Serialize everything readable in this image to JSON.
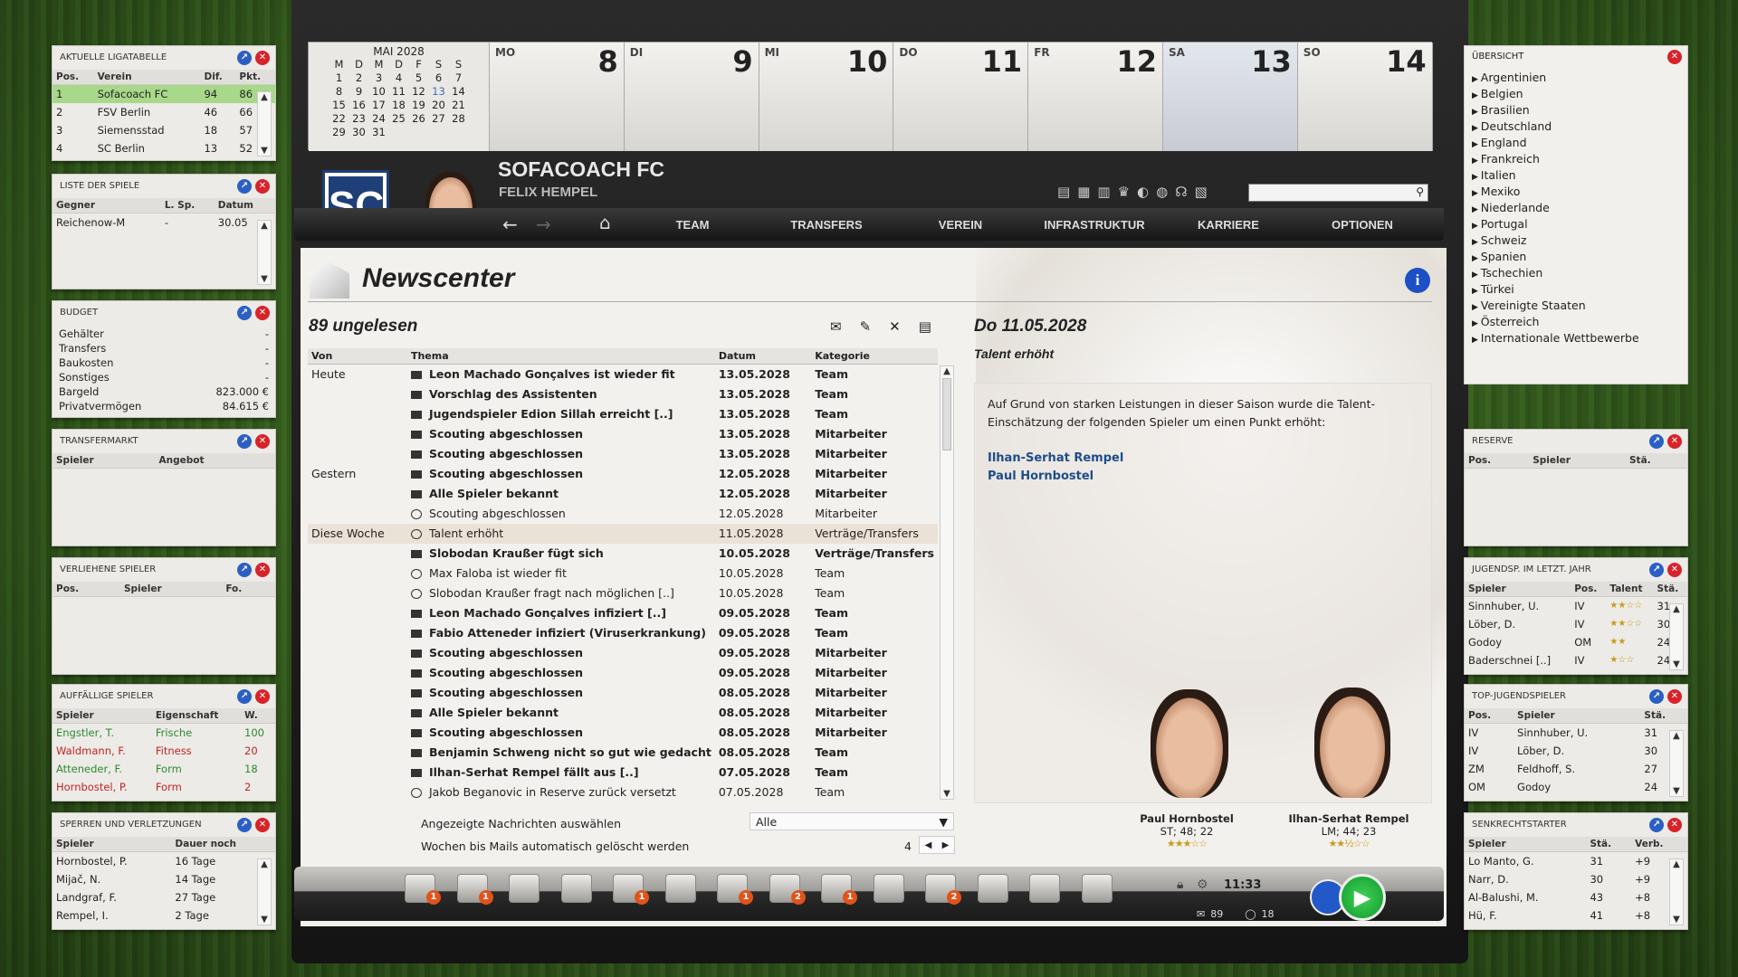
{
  "calendar": {
    "month": "MAI 2028",
    "weekdays": [
      "M",
      "D",
      "M",
      "D",
      "F",
      "S",
      "S"
    ],
    "rows": [
      [
        "1",
        "2",
        "3",
        "4",
        "5",
        "6",
        "7"
      ],
      [
        "8",
        "9",
        "10",
        "11",
        "12",
        "13",
        "14"
      ],
      [
        "15",
        "16",
        "17",
        "18",
        "19",
        "20",
        "21"
      ],
      [
        "22",
        "23",
        "24",
        "25",
        "26",
        "27",
        "28"
      ],
      [
        "29",
        "30",
        "31",
        "",
        "",
        "",
        ""
      ]
    ],
    "days": [
      {
        "label": "MO",
        "num": "8"
      },
      {
        "label": "DI",
        "num": "9"
      },
      {
        "label": "MI",
        "num": "10"
      },
      {
        "label": "DO",
        "num": "11"
      },
      {
        "label": "FR",
        "num": "12"
      },
      {
        "label": "SA",
        "num": "13"
      },
      {
        "label": "SO",
        "num": "14"
      }
    ]
  },
  "club": {
    "name": "SOFACOACH FC",
    "manager": "FELIX HEMPEL",
    "logo": "SC"
  },
  "nav": [
    "TEAM",
    "TRANSFERS",
    "VEREIN",
    "INFRASTRUKTUR",
    "KARRIERE",
    "OPTIONEN"
  ],
  "news": {
    "title": "Newscenter",
    "unread": "89 ungelesen",
    "headers": {
      "von": "Von",
      "thema": "Thema",
      "datum": "Datum",
      "kategorie": "Kategorie"
    },
    "rows": [
      {
        "von": "Heute",
        "thema": "Leon Machado Gonçalves ist wieder fit",
        "datum": "13.05.2028",
        "kat": "Team",
        "bold": true,
        "icon": "mail"
      },
      {
        "von": "",
        "thema": "Vorschlag des Assistenten",
        "datum": "13.05.2028",
        "kat": "Team",
        "bold": true,
        "icon": "mail"
      },
      {
        "von": "",
        "thema": "Jugendspieler Edion Sillah erreicht [..]",
        "datum": "13.05.2028",
        "kat": "Team",
        "bold": true,
        "icon": "mail"
      },
      {
        "von": "",
        "thema": "Scouting abgeschlossen",
        "datum": "13.05.2028",
        "kat": "Mitarbeiter",
        "bold": true,
        "icon": "mail"
      },
      {
        "von": "",
        "thema": "Scouting abgeschlossen",
        "datum": "13.05.2028",
        "kat": "Mitarbeiter",
        "bold": true,
        "icon": "mail"
      },
      {
        "von": "Gestern",
        "thema": "Scouting abgeschlossen",
        "datum": "12.05.2028",
        "kat": "Mitarbeiter",
        "bold": true,
        "icon": "mail"
      },
      {
        "von": "",
        "thema": "Alle Spieler bekannt",
        "datum": "12.05.2028",
        "kat": "Mitarbeiter",
        "bold": true,
        "icon": "mail"
      },
      {
        "von": "",
        "thema": "Scouting abgeschlossen",
        "datum": "12.05.2028",
        "kat": "Mitarbeiter",
        "bold": false,
        "icon": "bubble"
      },
      {
        "von": "Diese Woche",
        "thema": "Talent erhöht",
        "datum": "11.05.2028",
        "kat": "Verträge/Transfers",
        "bold": false,
        "icon": "bubble",
        "hl": true
      },
      {
        "von": "",
        "thema": "Slobodan Kraußer fügt sich",
        "datum": "10.05.2028",
        "kat": "Verträge/Transfers",
        "bold": true,
        "icon": "mail"
      },
      {
        "von": "",
        "thema": "Max Faloba ist wieder fit",
        "datum": "10.05.2028",
        "kat": "Team",
        "bold": false,
        "icon": "bubble"
      },
      {
        "von": "",
        "thema": "Slobodan Kraußer fragt nach möglichen [..]",
        "datum": "10.05.2028",
        "kat": "Team",
        "bold": false,
        "icon": "bubble"
      },
      {
        "von": "",
        "thema": "Leon Machado Gonçalves infiziert [..]",
        "datum": "09.05.2028",
        "kat": "Team",
        "bold": true,
        "icon": "mail"
      },
      {
        "von": "",
        "thema": "Fabio Atteneder infiziert (Viruserkrankung)",
        "datum": "09.05.2028",
        "kat": "Team",
        "bold": true,
        "icon": "mail"
      },
      {
        "von": "",
        "thema": "Scouting abgeschlossen",
        "datum": "09.05.2028",
        "kat": "Mitarbeiter",
        "bold": true,
        "icon": "mail"
      },
      {
        "von": "",
        "thema": "Scouting abgeschlossen",
        "datum": "09.05.2028",
        "kat": "Mitarbeiter",
        "bold": true,
        "icon": "mail"
      },
      {
        "von": "",
        "thema": "Scouting abgeschlossen",
        "datum": "08.05.2028",
        "kat": "Mitarbeiter",
        "bold": true,
        "icon": "mail"
      },
      {
        "von": "",
        "thema": "Alle Spieler bekannt",
        "datum": "08.05.2028",
        "kat": "Mitarbeiter",
        "bold": true,
        "icon": "mail"
      },
      {
        "von": "",
        "thema": "Scouting abgeschlossen",
        "datum": "08.05.2028",
        "kat": "Mitarbeiter",
        "bold": true,
        "icon": "mail"
      },
      {
        "von": "",
        "thema": "Benjamin Schweng nicht so gut wie gedacht",
        "datum": "08.05.2028",
        "kat": "Team",
        "bold": true,
        "icon": "mail"
      },
      {
        "von": "",
        "thema": "Ilhan-Serhat Rempel fällt aus [..]",
        "datum": "07.05.2028",
        "kat": "Team",
        "bold": true,
        "icon": "mail"
      },
      {
        "von": "",
        "thema": "Jakob Beganovic in Reserve zurück versetzt",
        "datum": "07.05.2028",
        "kat": "Team",
        "bold": false,
        "icon": "bubble"
      }
    ],
    "filter_label": "Angezeigte Nachrichten auswählen",
    "filter_value": "Alle",
    "weeks_label": "Wochen bis Mails automatisch gelöscht werden",
    "weeks_value": "4"
  },
  "detail": {
    "date": "Do 11.05.2028",
    "subject": "Talent erhöht",
    "body": "Auf Grund von starken Leistungen in dieser Saison wurde die Talent-Einschätzung der folgenden Spieler um einen Punkt erhöht:",
    "links": [
      "Ilhan-Serhat Rempel",
      "Paul Hornbostel"
    ],
    "players": [
      {
        "name": "Paul Hornbostel",
        "info": "ST; 48; 22",
        "stars": "★★★☆☆"
      },
      {
        "name": "Ilhan-Serhat Rempel",
        "info": "LM; 44; 23",
        "stars": "★★½☆☆"
      }
    ]
  },
  "status": {
    "time": "11:33",
    "mail_count": "89",
    "msg_count": "18"
  },
  "badges": [
    "1",
    "1",
    "1",
    "1",
    "2",
    "1",
    "2"
  ],
  "left": {
    "liga": {
      "title": "AKTUELLE LIGATABELLE",
      "headers": [
        "Pos.",
        "Verein",
        "Dif.",
        "Pkt."
      ],
      "rows": [
        [
          "1",
          "Sofacoach FC",
          "94",
          "86"
        ],
        [
          "2",
          "FSV Berlin",
          "46",
          "66"
        ],
        [
          "3",
          "Siemensstad",
          "18",
          "57"
        ],
        [
          "4",
          "SC Berlin",
          "13",
          "52"
        ]
      ]
    },
    "spiele": {
      "title": "LISTE DER SPIELE",
      "headers": [
        "Gegner",
        "L. Sp.",
        "Datum"
      ],
      "rows": [
        [
          "Reichenow-M",
          "-",
          "30.05"
        ]
      ]
    },
    "budget": {
      "title": "BUDGET",
      "rows": [
        [
          "Gehälter",
          "-"
        ],
        [
          "Transfers",
          "-"
        ],
        [
          "Baukosten",
          "-"
        ],
        [
          "Sonstiges",
          "-"
        ],
        [
          "Bargeld",
          "823.000 €"
        ],
        [
          "Privatvermögen",
          "84.615 €"
        ]
      ]
    },
    "transfer": {
      "title": "TRANSFERMARKT",
      "headers": [
        "Spieler",
        "Angebot"
      ]
    },
    "verliehen": {
      "title": "VERLIEHENE SPIELER",
      "headers": [
        "Pos.",
        "Spieler",
        "Fo."
      ]
    },
    "auffaellig": {
      "title": "AUFFÄLLIGE SPIELER",
      "headers": [
        "Spieler",
        "Eigenschaft",
        "W."
      ],
      "rows": [
        [
          "Engstler, T.",
          "Frische",
          "100",
          "green"
        ],
        [
          "Waldmann, F.",
          "Fitness",
          "20",
          "red"
        ],
        [
          "Atteneder, F.",
          "Form",
          "18",
          "green"
        ],
        [
          "Hornbostel, P.",
          "Form",
          "2",
          "red"
        ]
      ]
    },
    "sperren": {
      "title": "SPERREN UND VERLETZUNGEN",
      "headers": [
        "Spieler",
        "Dauer noch"
      ],
      "rows": [
        [
          "Hornbostel, P.",
          "16 Tage"
        ],
        [
          "Mijač, N.",
          "14 Tage"
        ],
        [
          "Landgraf, F.",
          "27 Tage"
        ],
        [
          "Rempel, I.",
          "2 Tage"
        ]
      ]
    }
  },
  "right": {
    "uebersicht": {
      "title": "ÜBERSICHT",
      "items": [
        "Argentinien",
        "Belgien",
        "Brasilien",
        "Deutschland",
        "England",
        "Frankreich",
        "Italien",
        "Mexiko",
        "Niederlande",
        "Portugal",
        "Schweiz",
        "Spanien",
        "Tschechien",
        "Türkei",
        "Vereinigte Staaten",
        "Österreich",
        "Internationale Wettbewerbe"
      ]
    },
    "reserve": {
      "title": "RESERVE",
      "headers": [
        "Pos.",
        "Spieler",
        "Stä."
      ]
    },
    "jugend": {
      "title": "JUGENDSP. IM LETZT. JAHR",
      "headers": [
        "Spieler",
        "Pos.",
        "Talent",
        "Stä."
      ],
      "rows": [
        [
          "Sinnhuber, U.",
          "IV",
          "★★☆☆",
          "31"
        ],
        [
          "Löber, D.",
          "IV",
          "★★☆☆",
          "30"
        ],
        [
          "Godoy",
          "OM",
          "★★",
          "24"
        ],
        [
          "Baderschnei [..]",
          "IV",
          "★☆☆",
          "24"
        ]
      ]
    },
    "topjugend": {
      "title": "TOP-JUGENDSPIELER",
      "headers": [
        "Pos.",
        "Spieler",
        "Stä."
      ],
      "rows": [
        [
          "IV",
          "Sinnhuber, U.",
          "31"
        ],
        [
          "IV",
          "Löber, D.",
          "30"
        ],
        [
          "ZM",
          "Feldhoff, S.",
          "27"
        ],
        [
          "OM",
          "Godoy",
          "24"
        ]
      ]
    },
    "senk": {
      "title": "SENKRECHTSTARTER",
      "headers": [
        "Spieler",
        "Stä.",
        "Verb."
      ],
      "rows": [
        [
          "Lo Manto, G.",
          "31",
          "+9"
        ],
        [
          "Narr, D.",
          "30",
          "+9"
        ],
        [
          "Al-Balushi, M.",
          "43",
          "+8"
        ],
        [
          "Hü, F.",
          "41",
          "+8"
        ]
      ]
    }
  }
}
